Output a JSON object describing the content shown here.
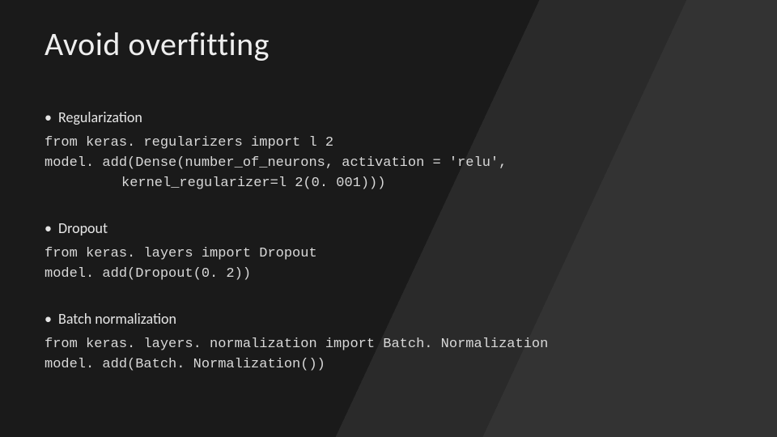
{
  "title": "Avoid overfitting",
  "sections": [
    {
      "heading": "Regularization",
      "code": [
        "from keras. regularizers import l 2",
        "model. add(Dense(number_of_neurons, activation = 'relu',",
        "kernel_regularizer=l 2(0. 001)))"
      ]
    },
    {
      "heading": "Dropout",
      "code": [
        "from keras. layers import Dropout",
        "model. add(Dropout(0. 2))"
      ]
    },
    {
      "heading": "Batch normalization",
      "code": [
        "from keras. layers. normalization import Batch. Normalization",
        "model. add(Batch. Normalization())"
      ]
    }
  ]
}
